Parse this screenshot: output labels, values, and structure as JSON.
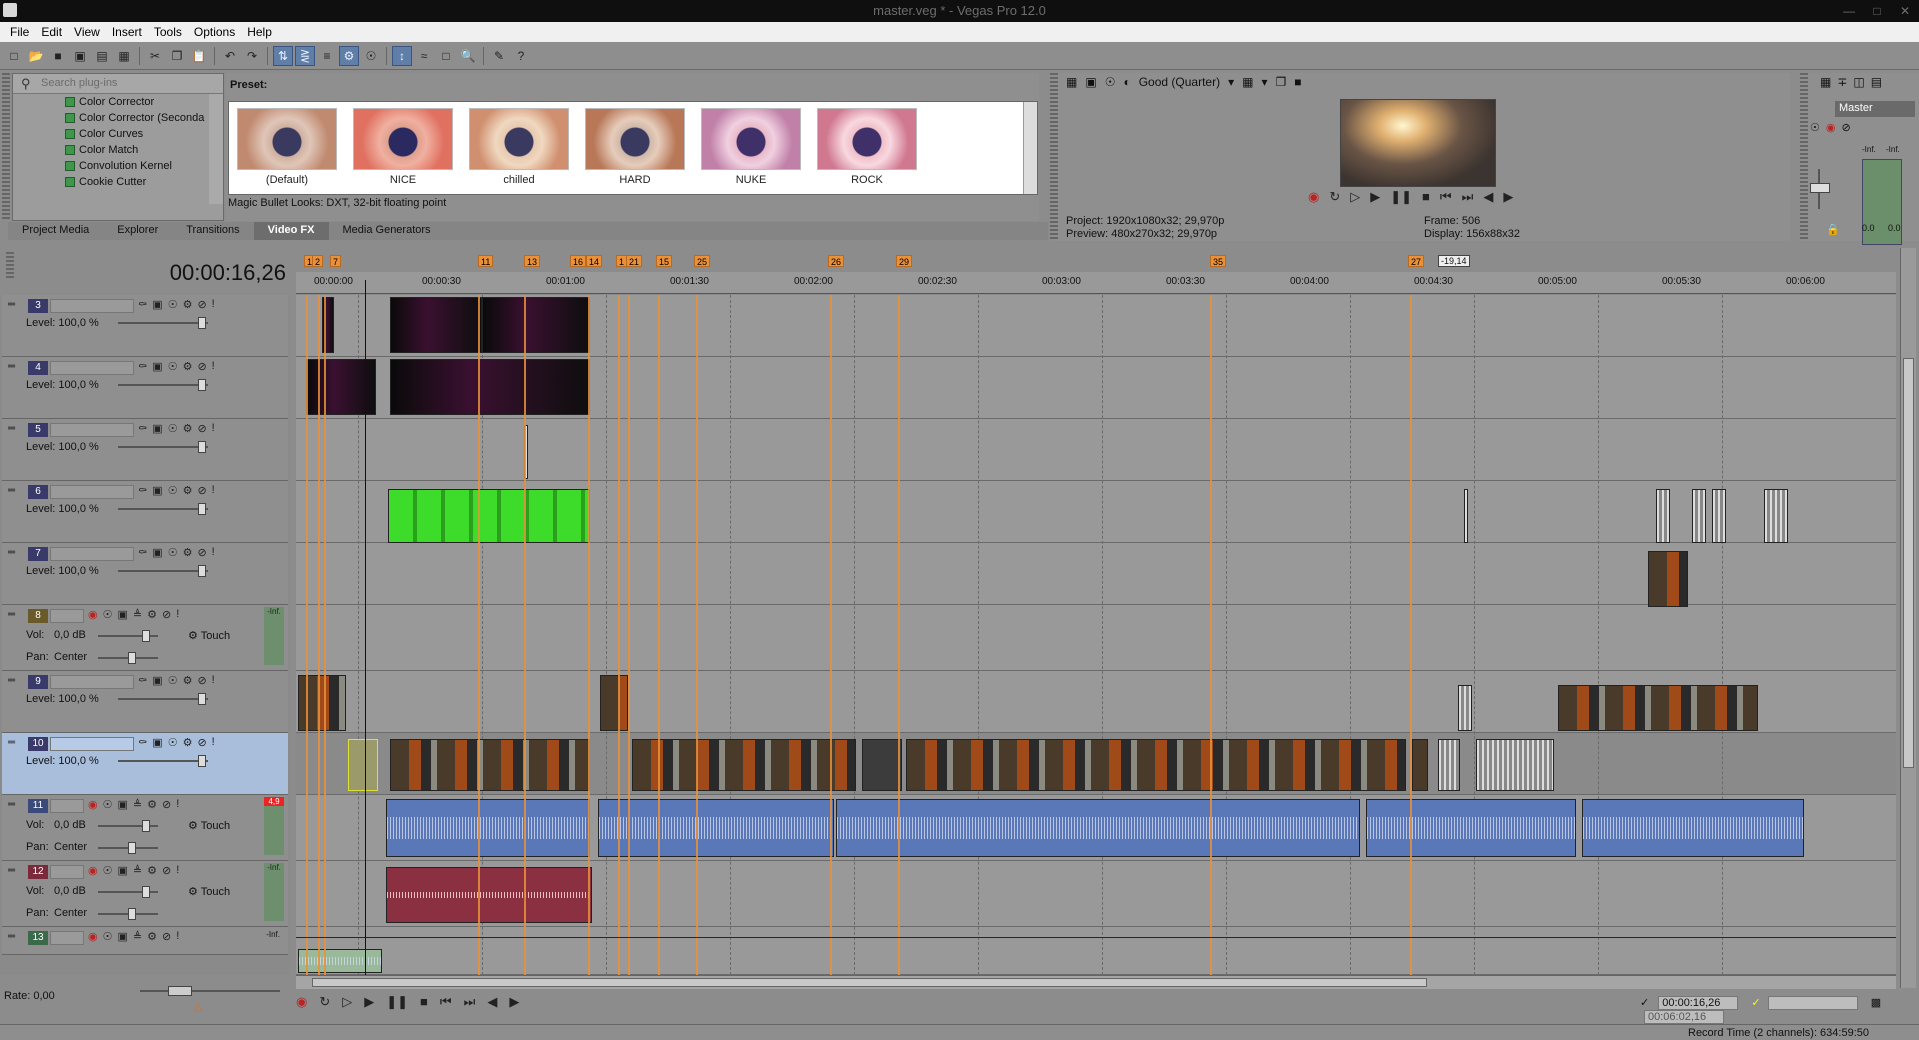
{
  "window": {
    "title": "master.veg * - Vegas Pro 12.0"
  },
  "menu": [
    "File",
    "Edit",
    "View",
    "Insert",
    "Tools",
    "Options",
    "Help"
  ],
  "plugins": {
    "search_placeholder": "Search plug-ins",
    "items": [
      "Color Corrector",
      "Color Corrector (Seconda",
      "Color Curves",
      "Color Match",
      "Convolution Kernel",
      "Cookie Cutter"
    ]
  },
  "tabs": [
    "Project Media",
    "Explorer",
    "Transitions",
    "Video FX",
    "Media Generators"
  ],
  "preset": {
    "label": "Preset:",
    "items": [
      "(Default)",
      "NICE",
      "chilled",
      "HARD",
      "NUKE",
      "ROCK"
    ],
    "description": "Magic Bullet Looks: DXT, 32-bit floating point"
  },
  "preview": {
    "quality": "Good (Quarter)",
    "project": "Project:  1920x1080x32; 29,970p",
    "preview": "Preview:  480x270x32; 29,970p",
    "frame": "Frame:    506",
    "display": "Display:  156x88x32"
  },
  "master": {
    "title": "Master",
    "left_peak": "-Inf.",
    "right_peak": "-Inf.",
    "left_val": "0.0",
    "right_val": "0.0"
  },
  "timeline": {
    "timecode": "00:00:16,26",
    "region_box": "-19,14",
    "markers": [
      "1",
      "2",
      "7",
      "11",
      "13",
      "16",
      "14",
      "1",
      "21",
      "15",
      "25",
      "26",
      "29",
      "35",
      "27"
    ],
    "ruler": [
      "00:00:00",
      "00:00:30",
      "00:01:00",
      "00:01:30",
      "00:02:00",
      "00:02:30",
      "00:03:00",
      "00:03:30",
      "00:04:00",
      "00:04:30",
      "00:05:00",
      "00:05:30",
      "00:06:00"
    ]
  },
  "tracks": [
    {
      "num": "3",
      "type": "video",
      "level": "Level: 100,0 %"
    },
    {
      "num": "4",
      "type": "video",
      "level": "Level: 100,0 %"
    },
    {
      "num": "5",
      "type": "video",
      "level": "Level: 100,0 %"
    },
    {
      "num": "6",
      "type": "video",
      "level": "Level: 100,0 %"
    },
    {
      "num": "7",
      "type": "video",
      "level": "Level: 100,0 %"
    },
    {
      "num": "8",
      "type": "audio",
      "vol": "Vol:",
      "volval": "0,0 dB",
      "pan": "Pan:",
      "panval": "Center",
      "mode": "Touch",
      "peak": "-Inf."
    },
    {
      "num": "9",
      "type": "video",
      "level": "Level: 100,0 %"
    },
    {
      "num": "10",
      "type": "video",
      "level": "Level: 100,0 %"
    },
    {
      "num": "11",
      "type": "audio",
      "vol": "Vol:",
      "volval": "0,0 dB",
      "pan": "Pan:",
      "panval": "Center",
      "mode": "Touch",
      "peak": "4,9"
    },
    {
      "num": "12",
      "type": "audio",
      "vol": "Vol:",
      "volval": "0,0 dB",
      "pan": "Pan:",
      "panval": "Center",
      "mode": "Touch",
      "peak": "-Inf."
    },
    {
      "num": "13",
      "type": "audio",
      "peak": "-Inf."
    }
  ],
  "footer": {
    "rate": "Rate: 0,00",
    "cursor_time": "00:00:16,26",
    "length": "00:06:02,16",
    "status": "Record Time (2 channels): 634:59:50"
  }
}
